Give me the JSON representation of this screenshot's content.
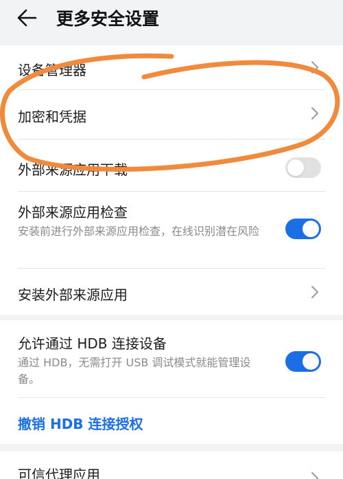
{
  "header": {
    "title": "更多安全设置"
  },
  "group1": {
    "device_admin": "设备管理器",
    "encryption": "加密和凭据",
    "external_download": {
      "label": "外部来源应用下载",
      "enabled": false
    },
    "external_check": {
      "label": "外部来源应用检查",
      "desc": "安装前进行外部来源应用检查，在线识别潜在风险",
      "enabled": true
    },
    "install_external": "安装外部来源应用"
  },
  "group2": {
    "hdb": {
      "label": "允许通过 HDB 连接设备",
      "desc": "通过 HDB，无需打开 USB 调试模式就能管理设备。",
      "enabled": true
    },
    "revoke": "撤销 HDB 连接授权"
  },
  "group3": {
    "trusted_agents": "可信代理应用"
  },
  "colors": {
    "accent": "#1a6fe5",
    "annotation": "#f08a3c",
    "background": "#f1f3f5"
  }
}
